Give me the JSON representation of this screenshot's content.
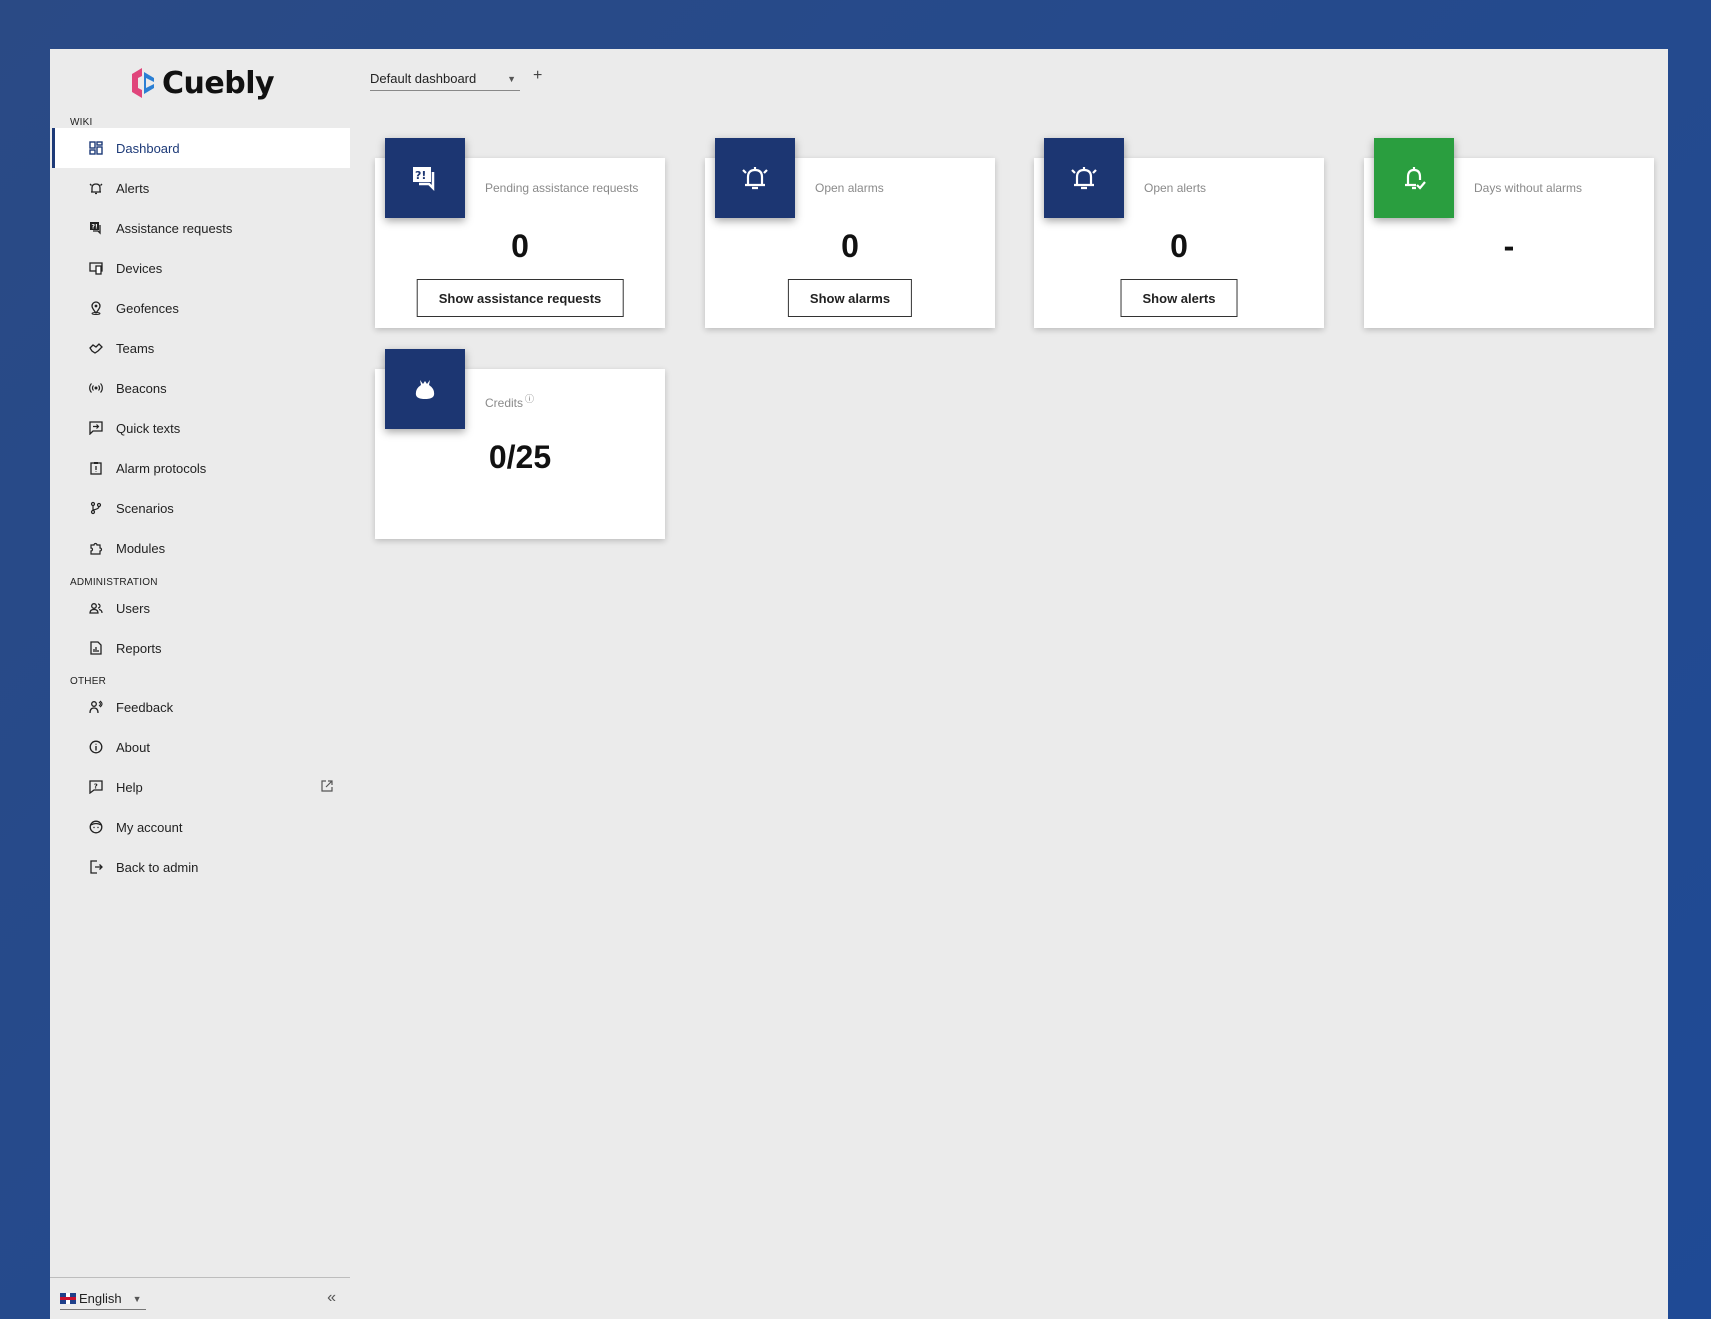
{
  "app": {
    "name": "Cuebly"
  },
  "sidebar": {
    "sections": {
      "wiki": "WIKI",
      "administration": "ADMINISTRATION",
      "other": "OTHER"
    },
    "items": {
      "dashboard": "Dashboard",
      "alerts": "Alerts",
      "assistance_requests": "Assistance requests",
      "devices": "Devices",
      "geofences": "Geofences",
      "teams": "Teams",
      "beacons": "Beacons",
      "quick_texts": "Quick texts",
      "alarm_protocols": "Alarm protocols",
      "scenarios": "Scenarios",
      "modules": "Modules",
      "users": "Users",
      "reports": "Reports",
      "feedback": "Feedback",
      "about": "About",
      "help": "Help",
      "my_account": "My account",
      "back_to_admin": "Back to admin"
    },
    "language": "English",
    "collapse": "«"
  },
  "header": {
    "dashboard_select": "Default dashboard",
    "add": "+"
  },
  "cards": {
    "pending": {
      "title": "Pending assistance requests",
      "value": "0",
      "button": "Show assistance requests"
    },
    "alarms": {
      "title": "Open alarms",
      "value": "0",
      "button": "Show alarms"
    },
    "alerts": {
      "title": "Open alerts",
      "value": "0",
      "button": "Show alerts"
    },
    "days": {
      "title": "Days without alarms",
      "value": "-"
    },
    "credits": {
      "title": "Credits",
      "value": "0/25"
    }
  },
  "colors": {
    "accent": "#1c3672",
    "success": "#2a9e3f",
    "background": "#ebebeb"
  }
}
